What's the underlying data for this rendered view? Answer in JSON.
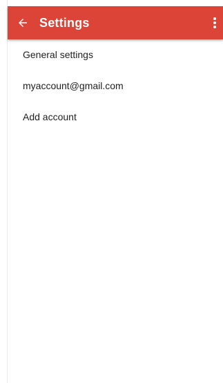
{
  "app_bar": {
    "title": "Settings",
    "back_icon": "arrow-left-icon",
    "overflow_icon": "more-vert-icon",
    "background_color": "#db4437",
    "text_color": "#ffffff"
  },
  "settings_list": {
    "items": [
      {
        "label": "General settings"
      },
      {
        "label": "myaccount@gmail.com"
      },
      {
        "label": "Add account"
      }
    ]
  }
}
